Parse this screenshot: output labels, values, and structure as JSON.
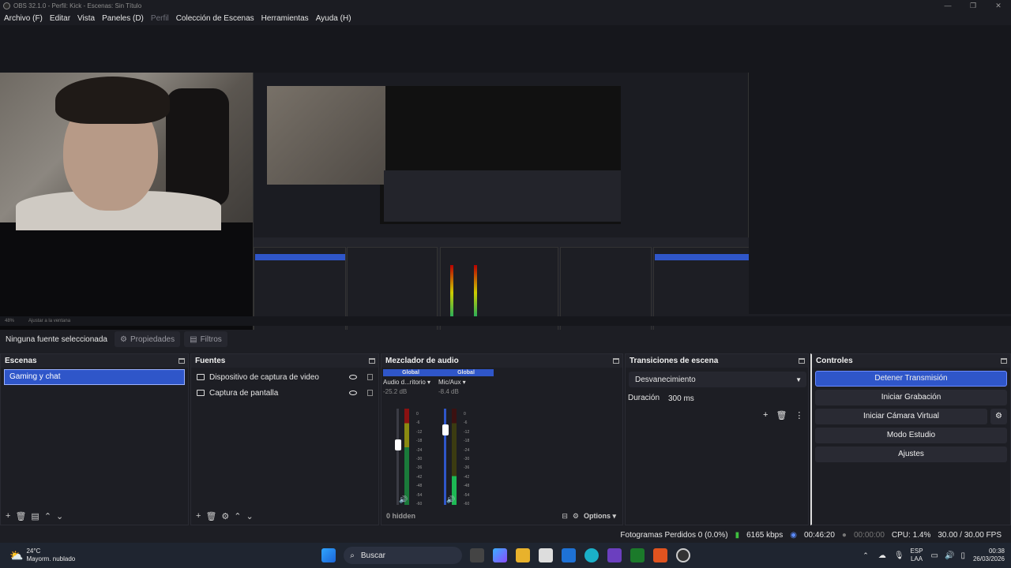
{
  "window": {
    "title": "OBS 32.1.0 - Perfil: Kick - Escenas: Sin Título"
  },
  "menu": [
    "Archivo (F)",
    "Editar",
    "Vista",
    "Paneles (D)",
    "Perfil",
    "Colección de Escenas",
    "Herramientas",
    "Ayuda (H)"
  ],
  "zoom": {
    "value": "48%",
    "fit": "Ajustar a la ventana"
  },
  "source_toolbar": {
    "selection": "Ninguna fuente seleccionada",
    "properties": "Propiedades",
    "filters": "Filtros"
  },
  "scenes": {
    "title": "Escenas",
    "items": [
      "Gaming y chat"
    ]
  },
  "sources": {
    "title": "Fuentes",
    "items": [
      "Dispositivo de captura de video",
      "Captura de pantalla"
    ]
  },
  "mixer": {
    "title": "Mezclador de audio",
    "channels": [
      {
        "scope": "Global",
        "name": "Audio d...ritorio",
        "db": "-25.2 dB",
        "level": 0.62
      },
      {
        "scope": "Global",
        "name": "Mic/Aux",
        "db": "-8.4 dB",
        "level": 0.78
      }
    ],
    "ticks": [
      "0",
      "-6",
      "-12",
      "-18",
      "-24",
      "-30",
      "-36",
      "-42",
      "-48",
      "-54",
      "-60"
    ],
    "hidden": "0 hidden",
    "options": "Options"
  },
  "transitions": {
    "title": "Transiciones de escena",
    "type": "Desvanecimiento",
    "duration_label": "Duración",
    "duration": "300 ms"
  },
  "controls": {
    "title": "Controles",
    "stop_stream": "Detener Transmisión",
    "start_recording": "Iniciar Grabación",
    "virtual_camera": "Iniciar Cámara Virtual",
    "studio_mode": "Modo Estudio",
    "settings": "Ajustes"
  },
  "status": {
    "dropped": "Fotogramas Perdidos 0 (0.0%)",
    "bitrate": "6165 kbps",
    "stream_time": "00:46:20",
    "rec_time": "00:00:00",
    "cpu": "CPU: 1.4%",
    "fps": "30.00 / 30.00 FPS"
  },
  "taskbar": {
    "weather_temp": "24°C",
    "weather_desc": "Mayorm. nublado",
    "search": "Buscar",
    "lang": "ESP",
    "region": "LAA",
    "time": "00:38",
    "date": "26/03/2026"
  }
}
